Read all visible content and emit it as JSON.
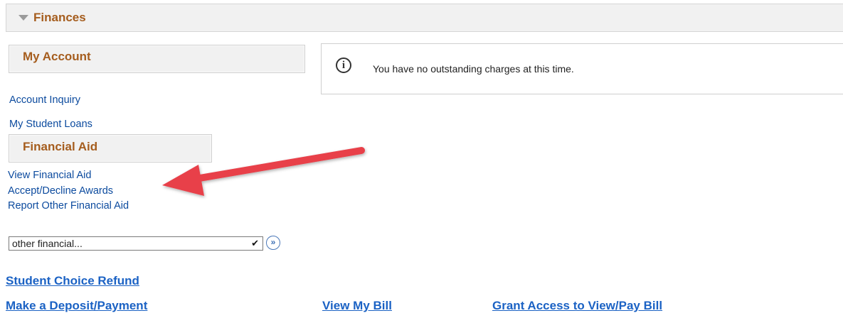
{
  "finances": {
    "title": "Finances"
  },
  "my_account": {
    "title": "My Account",
    "links": [
      "Account Inquiry",
      "My Student Loans"
    ]
  },
  "message": {
    "text": "You have no outstanding charges at this time."
  },
  "financial_aid": {
    "title": "Financial Aid",
    "links": [
      "View Financial Aid",
      "Accept/Decline Awards",
      "Report Other Financial Aid"
    ]
  },
  "dropdown": {
    "selected": "other financial..."
  },
  "bottom_links": {
    "student_choice_refund": "Student Choice Refund",
    "make_deposit": "Make a Deposit/Payment",
    "view_bill": "View My Bill",
    "grant_access": "Grant Access to View/Pay Bill"
  },
  "colors": {
    "heading": "#a55d1e",
    "link": "#0b4a9e",
    "big_link": "#1b62c4",
    "annotation_arrow": "#e8404a"
  },
  "icons": [
    "collapse-triangle-icon",
    "info-icon",
    "dropdown-chevron-icon",
    "go-arrow-icon",
    "annotation-arrow"
  ]
}
